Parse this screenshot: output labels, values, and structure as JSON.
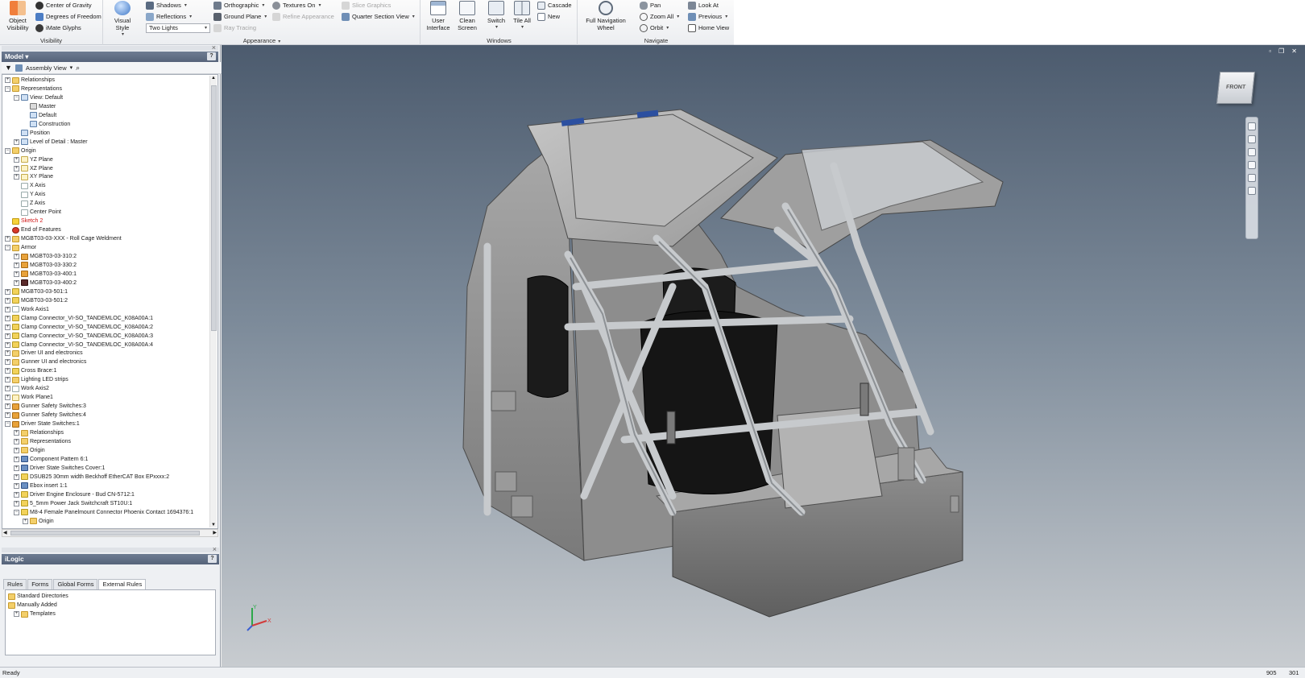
{
  "ribbon": {
    "visibility": {
      "title": "Visibility",
      "object_visibility": "Object\nVisibility",
      "center_of_gravity": "Center of Gravity",
      "degrees_of_freedom": "Degrees of Freedom",
      "imate_glyphs": "iMate Glyphs"
    },
    "appearance": {
      "title": "Appearance",
      "visual_style": "Visual Style",
      "shadows": "Shadows",
      "reflections": "Reflections",
      "lighting": "Two Lights",
      "orthographic": "Orthographic",
      "ground_plane": "Ground Plane",
      "ray_tracing": "Ray Tracing",
      "textures_on": "Textures On",
      "refine_appearance": "Refine Appearance",
      "slice_graphics": "Slice Graphics",
      "quarter_section_view": "Quarter Section View"
    },
    "windows": {
      "title": "Windows",
      "user_interface": "User\nInterface",
      "clean_screen": "Clean\nScreen",
      "switch": "Switch",
      "tile_all": "Tile All",
      "cascade": "Cascade",
      "new": "New"
    },
    "navigate": {
      "title": "Navigate",
      "full_navigation_wheel": "Full Navigation\nWheel",
      "pan": "Pan",
      "zoom_all": "Zoom All",
      "orbit": "Orbit",
      "look_at": "Look At",
      "previous": "Previous",
      "home_view": "Home View"
    }
  },
  "model_panel": {
    "title": "Model",
    "view_mode": "Assembly View",
    "tree": [
      {
        "label": "Relationships",
        "indent": 0,
        "icon": "folder",
        "exp": "+"
      },
      {
        "label": "Representations",
        "indent": 0,
        "icon": "folder",
        "exp": "-"
      },
      {
        "label": "View: Default",
        "indent": 1,
        "icon": "view",
        "exp": "-"
      },
      {
        "label": "Master",
        "indent": 2,
        "icon": "lock",
        "exp": ""
      },
      {
        "label": "Default",
        "indent": 2,
        "icon": "view",
        "exp": ""
      },
      {
        "label": "Construction",
        "indent": 2,
        "icon": "view",
        "exp": ""
      },
      {
        "label": "Position",
        "indent": 1,
        "icon": "view",
        "exp": ""
      },
      {
        "label": "Level of Detail : Master",
        "indent": 1,
        "icon": "view",
        "exp": "+"
      },
      {
        "label": "Origin",
        "indent": 0,
        "icon": "folder",
        "exp": "-"
      },
      {
        "label": "YZ Plane",
        "indent": 1,
        "icon": "plane",
        "exp": "+"
      },
      {
        "label": "XZ Plane",
        "indent": 1,
        "icon": "plane",
        "exp": "+"
      },
      {
        "label": "XY Plane",
        "indent": 1,
        "icon": "plane",
        "exp": "+"
      },
      {
        "label": "X Axis",
        "indent": 1,
        "icon": "axis",
        "exp": ""
      },
      {
        "label": "Y Axis",
        "indent": 1,
        "icon": "axis",
        "exp": ""
      },
      {
        "label": "Z Axis",
        "indent": 1,
        "icon": "axis",
        "exp": ""
      },
      {
        "label": "Center Point",
        "indent": 1,
        "icon": "axis",
        "exp": ""
      },
      {
        "label": "Sketch 2",
        "indent": 0,
        "icon": "warn",
        "exp": "",
        "red": true
      },
      {
        "label": "End of Features",
        "indent": 0,
        "icon": "end",
        "exp": ""
      },
      {
        "label": "MGBT03-03-XXX - Roll Cage Weldment",
        "indent": 0,
        "icon": "folder",
        "exp": "+"
      },
      {
        "label": "Armor",
        "indent": 0,
        "icon": "folder",
        "exp": "-"
      },
      {
        "label": "MGBT03-03-310:2",
        "indent": 1,
        "icon": "asm",
        "exp": "+"
      },
      {
        "label": "MGBT03-03-330:2",
        "indent": 1,
        "icon": "asm",
        "exp": "+"
      },
      {
        "label": "MGBT03-03-400:1",
        "indent": 1,
        "icon": "asm",
        "exp": "+"
      },
      {
        "label": "MGBT03-03-400:2",
        "indent": 1,
        "icon": "dark",
        "exp": "+"
      },
      {
        "label": "MGBT03-03-501:1",
        "indent": 0,
        "icon": "part",
        "exp": "+"
      },
      {
        "label": "MGBT03-03-501:2",
        "indent": 0,
        "icon": "part",
        "exp": "+"
      },
      {
        "label": "Work Axis1",
        "indent": 0,
        "icon": "axis",
        "exp": "+"
      },
      {
        "label": "Clamp Connector_VI-SO_TANDEMLOC_K08A00A:1",
        "indent": 0,
        "icon": "part",
        "exp": "+"
      },
      {
        "label": "Clamp Connector_VI-SO_TANDEMLOC_K08A00A:2",
        "indent": 0,
        "icon": "part",
        "exp": "+"
      },
      {
        "label": "Clamp Connector_VI-SO_TANDEMLOC_K08A00A:3",
        "indent": 0,
        "icon": "part",
        "exp": "+"
      },
      {
        "label": "Clamp Connector_VI-SO_TANDEMLOC_K08A00A:4",
        "indent": 0,
        "icon": "part",
        "exp": "+"
      },
      {
        "label": "Driver UI and electronics",
        "indent": 0,
        "icon": "folder",
        "exp": "+"
      },
      {
        "label": "Gunner UI and electronics",
        "indent": 0,
        "icon": "folder",
        "exp": "+"
      },
      {
        "label": "Cross Brace:1",
        "indent": 0,
        "icon": "part",
        "exp": "+"
      },
      {
        "label": "Lighting LED strips",
        "indent": 0,
        "icon": "folder",
        "exp": "+"
      },
      {
        "label": "Work Axis2",
        "indent": 0,
        "icon": "axis",
        "exp": "+"
      },
      {
        "label": "Work Plane1",
        "indent": 0,
        "icon": "plane",
        "exp": "+"
      },
      {
        "label": "Gunner Safety Switches:3",
        "indent": 0,
        "icon": "asm",
        "exp": "+"
      },
      {
        "label": "Gunner Safety Switches:4",
        "indent": 0,
        "icon": "asm",
        "exp": "+"
      },
      {
        "label": "Driver State Switches:1",
        "indent": 0,
        "icon": "asm",
        "exp": "-"
      },
      {
        "label": "Relationships",
        "indent": 1,
        "icon": "folder",
        "exp": "+"
      },
      {
        "label": "Representations",
        "indent": 1,
        "icon": "folder",
        "exp": "+"
      },
      {
        "label": "Origin",
        "indent": 1,
        "icon": "folder",
        "exp": "+"
      },
      {
        "label": "Component Pattern 6:1",
        "indent": 1,
        "icon": "pattern",
        "exp": "+"
      },
      {
        "label": "Driver State Switches Cover:1",
        "indent": 1,
        "icon": "pattern",
        "exp": "+"
      },
      {
        "label": "DSUB25 30mm width Beckhoff EtherCAT Box EPxxxx:2",
        "indent": 1,
        "icon": "part",
        "exp": "+"
      },
      {
        "label": "Ebox insert 1:1",
        "indent": 1,
        "icon": "pattern",
        "exp": "+"
      },
      {
        "label": "Driver Engine Enclosure - Bud CN-5712:1",
        "indent": 1,
        "icon": "part",
        "exp": "+"
      },
      {
        "label": "5_5mm Power Jack Switchcraft ST10U:1",
        "indent": 1,
        "icon": "part",
        "exp": "+"
      },
      {
        "label": "M8-4 Female Panelmount Connector Phoenix Contact 1694376:1",
        "indent": 1,
        "icon": "part",
        "exp": "-"
      },
      {
        "label": "Origin",
        "indent": 2,
        "icon": "folder",
        "exp": "+"
      }
    ]
  },
  "ilogic_panel": {
    "title": "iLogic",
    "tabs": [
      "Rules",
      "Forms",
      "Global Forms",
      "External Rules"
    ],
    "active_tab": "External Rules",
    "items": [
      {
        "label": "Standard Directories",
        "indent": 0
      },
      {
        "label": "Manually Added",
        "indent": 0
      },
      {
        "label": "Templates",
        "indent": 1
      }
    ]
  },
  "viewport": {
    "viewcube_face": "FRONT",
    "triad_y": "Y",
    "triad_x": "X"
  },
  "status_bar": {
    "text": "Ready",
    "value1": "905",
    "value2": "301"
  }
}
